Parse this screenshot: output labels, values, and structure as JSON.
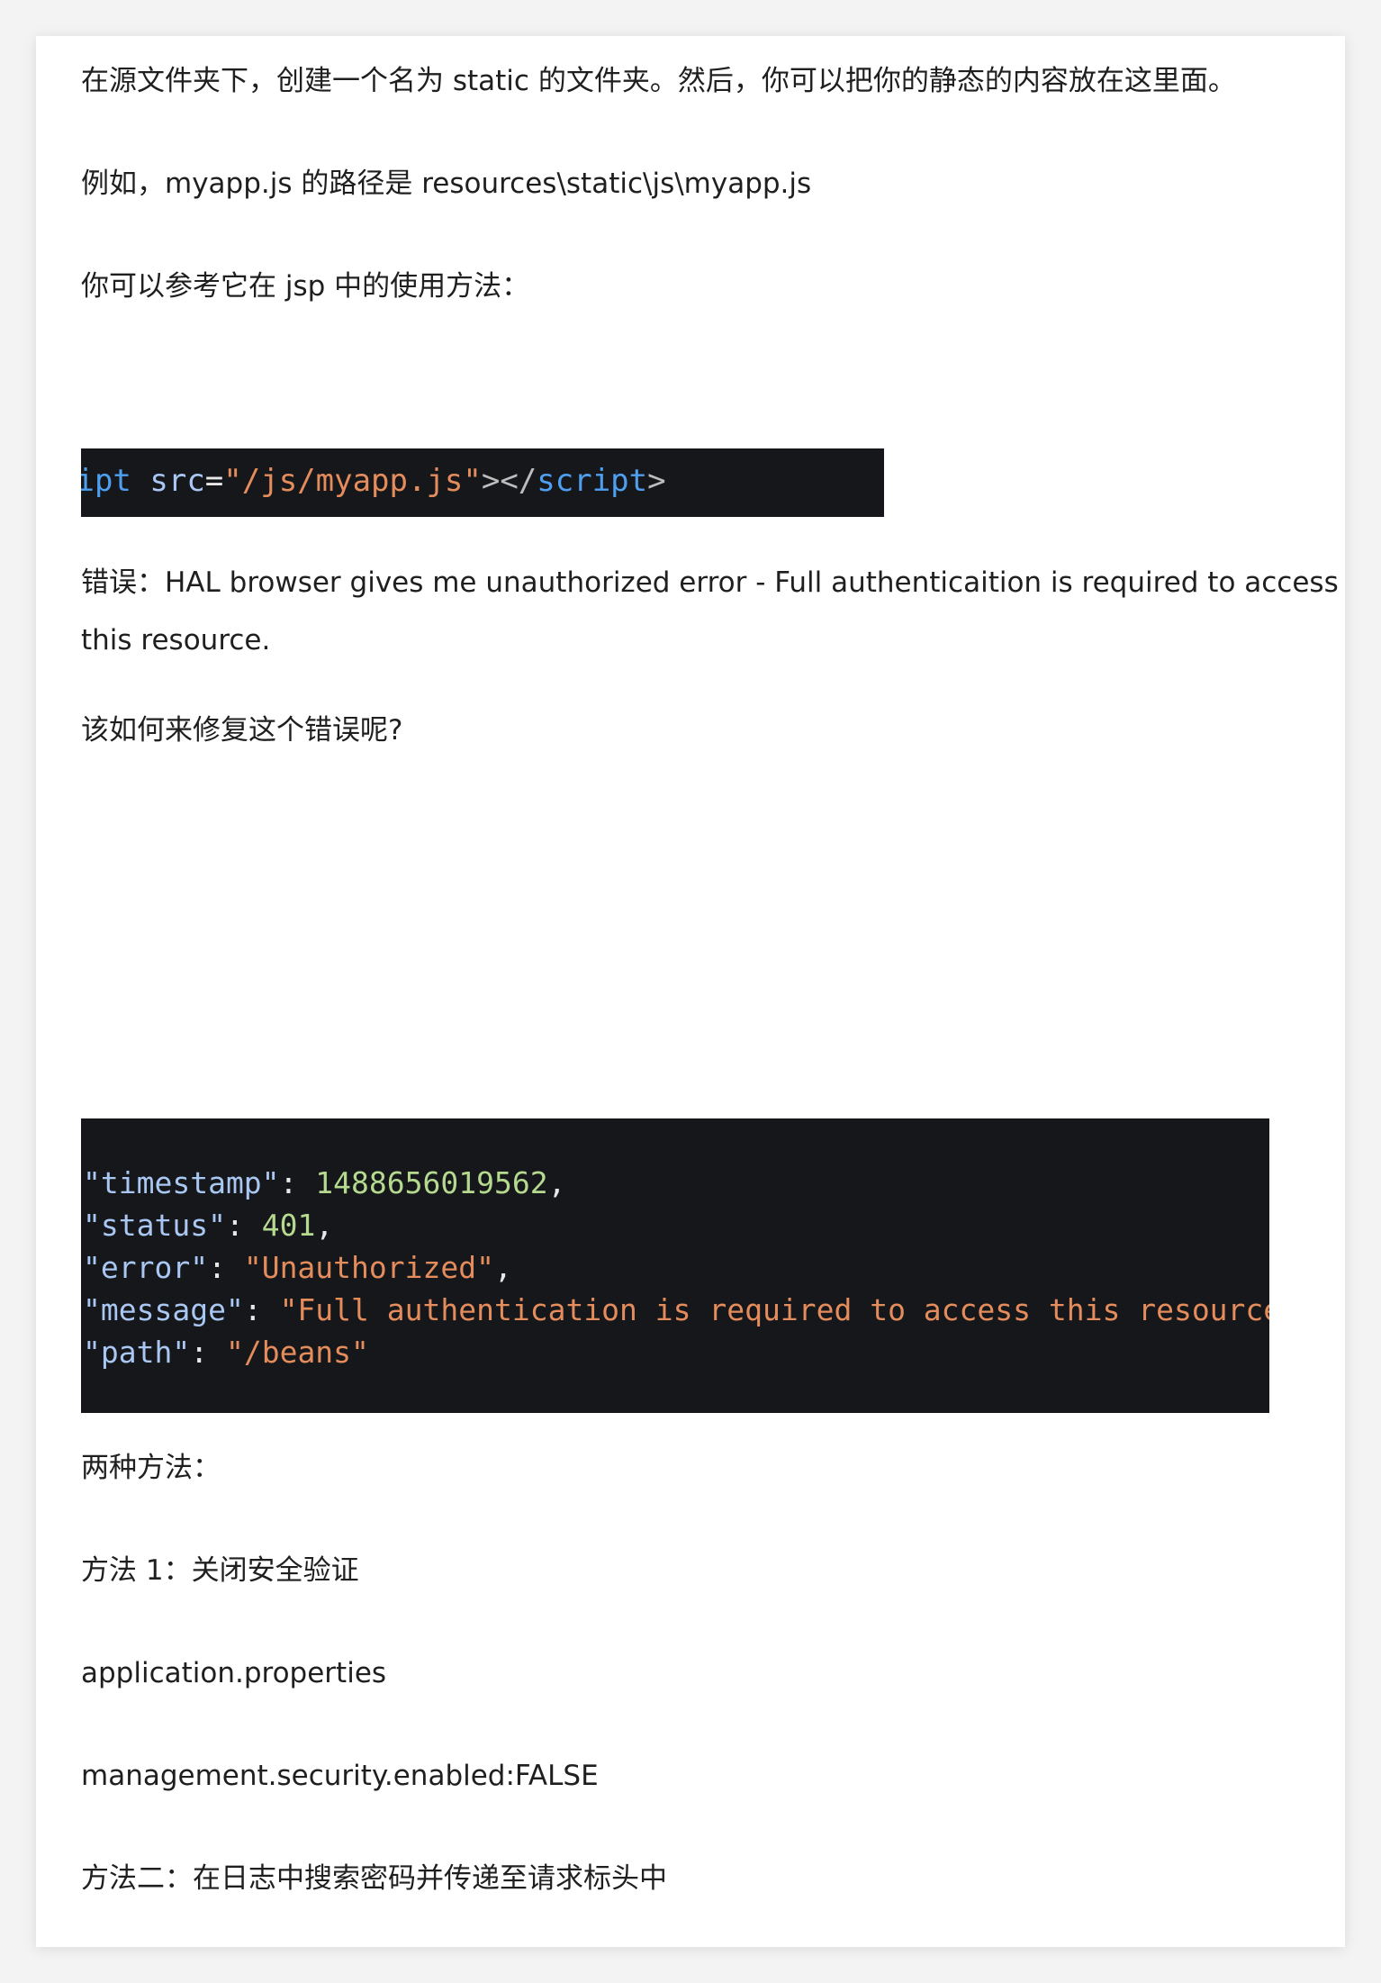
{
  "paragraphs": {
    "p1": "在源文件夹下，创建一个名为 static 的文件夹。然后，你可以把你的静态的内容放在这里面。",
    "p2": "例如，myapp.js 的路径是 resources\\static\\js\\myapp.js",
    "p3": "你可以参考它在 jsp 中的使用方法：",
    "p4": "错误：HAL browser gives me unauthorized error - Full authenticaition is required to access this resource.",
    "p5": "该如何来修复这个错误呢?",
    "p6": "两种方法：",
    "p7": "方法 1：关闭安全验证",
    "p8": "application.properties",
    "p9": "management.security.enabled:FALSE",
    "p10": "方法二：在日志中搜索密码并传递至请求标头中"
  },
  "code_snippet_1": {
    "tag_open": "ript",
    "attr": "src",
    "equals": "=",
    "value": "\"/js/myapp.js\"",
    "tag_close_punct": "></",
    "tag_close": "script",
    "end": ">"
  },
  "code_snippet_2": {
    "lines": [
      {
        "key": "\"timestamp\"",
        "colon": ": ",
        "value": "1488656019562",
        "value_type": "number",
        "trail": ","
      },
      {
        "key": "\"status\"",
        "colon": ": ",
        "value": "401",
        "value_type": "number",
        "trail": ","
      },
      {
        "key": "\"error\"",
        "colon": ": ",
        "value": "\"Unauthorized\"",
        "value_type": "string",
        "trail": ","
      },
      {
        "key": "\"message\"",
        "colon": ": ",
        "value": "\"Full authentication is required to access this resource.\"",
        "value_type": "string",
        "trail": ","
      },
      {
        "key": "\"path\"",
        "colon": ": ",
        "value": "\"/beans\"",
        "value_type": "string",
        "trail": ""
      }
    ]
  },
  "colors": {
    "page_background": "#f3f3f3",
    "card_background": "#ffffff",
    "text": "#1f1f1f",
    "code_background": "#15171a",
    "code_tag": "#4f9ff0",
    "code_key": "#a9c7f2",
    "code_string": "#e48c5c",
    "code_number": "#b5d98f"
  }
}
